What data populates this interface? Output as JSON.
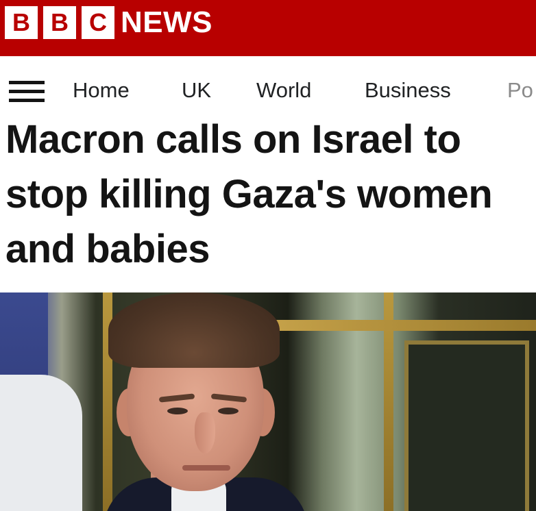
{
  "masthead": {
    "brand_letters": [
      "B",
      "B",
      "C"
    ],
    "section": "NEWS",
    "background_color": "#b80000"
  },
  "nav": {
    "menu_icon": "hamburger-menu-icon",
    "items": [
      {
        "label": "Home"
      },
      {
        "label": "UK"
      },
      {
        "label": "World"
      },
      {
        "label": "Business"
      },
      {
        "label": "Po"
      }
    ]
  },
  "article": {
    "headline": "Macron calls on Israel to stop killing Gaza's women and babies"
  },
  "colors": {
    "brand_red": "#b80000",
    "headline_text": "#141414",
    "nav_text": "#202224"
  }
}
